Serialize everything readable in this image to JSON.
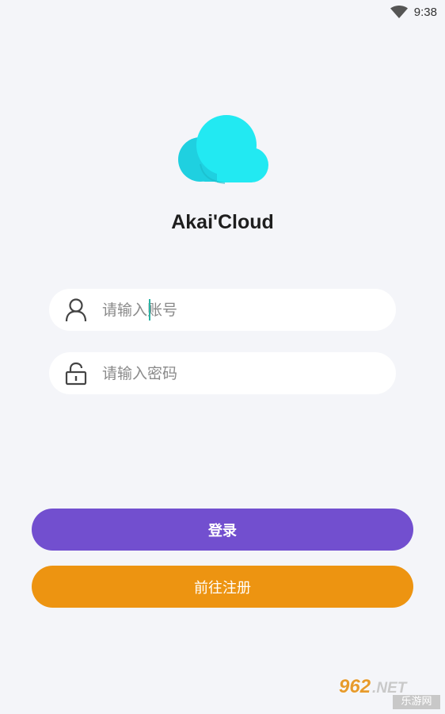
{
  "status_bar": {
    "time": "9:38",
    "wifi_icon": "wifi-icon"
  },
  "app": {
    "title": "Akai'Cloud",
    "logo_icon": "cloud-icon",
    "logo_color": "#22e3ef"
  },
  "login_form": {
    "username": {
      "value": "",
      "placeholder": "请输入账号",
      "icon": "user-icon"
    },
    "password": {
      "value": "",
      "placeholder": "请输入密码",
      "icon": "lock-icon"
    }
  },
  "buttons": {
    "login_label": "登录",
    "login_color": "#724fcf",
    "register_label": "前往注册",
    "register_color": "#ed9411"
  },
  "watermark": {
    "number": "962",
    "suffix": ".NET",
    "subtitle": "乐游网"
  }
}
